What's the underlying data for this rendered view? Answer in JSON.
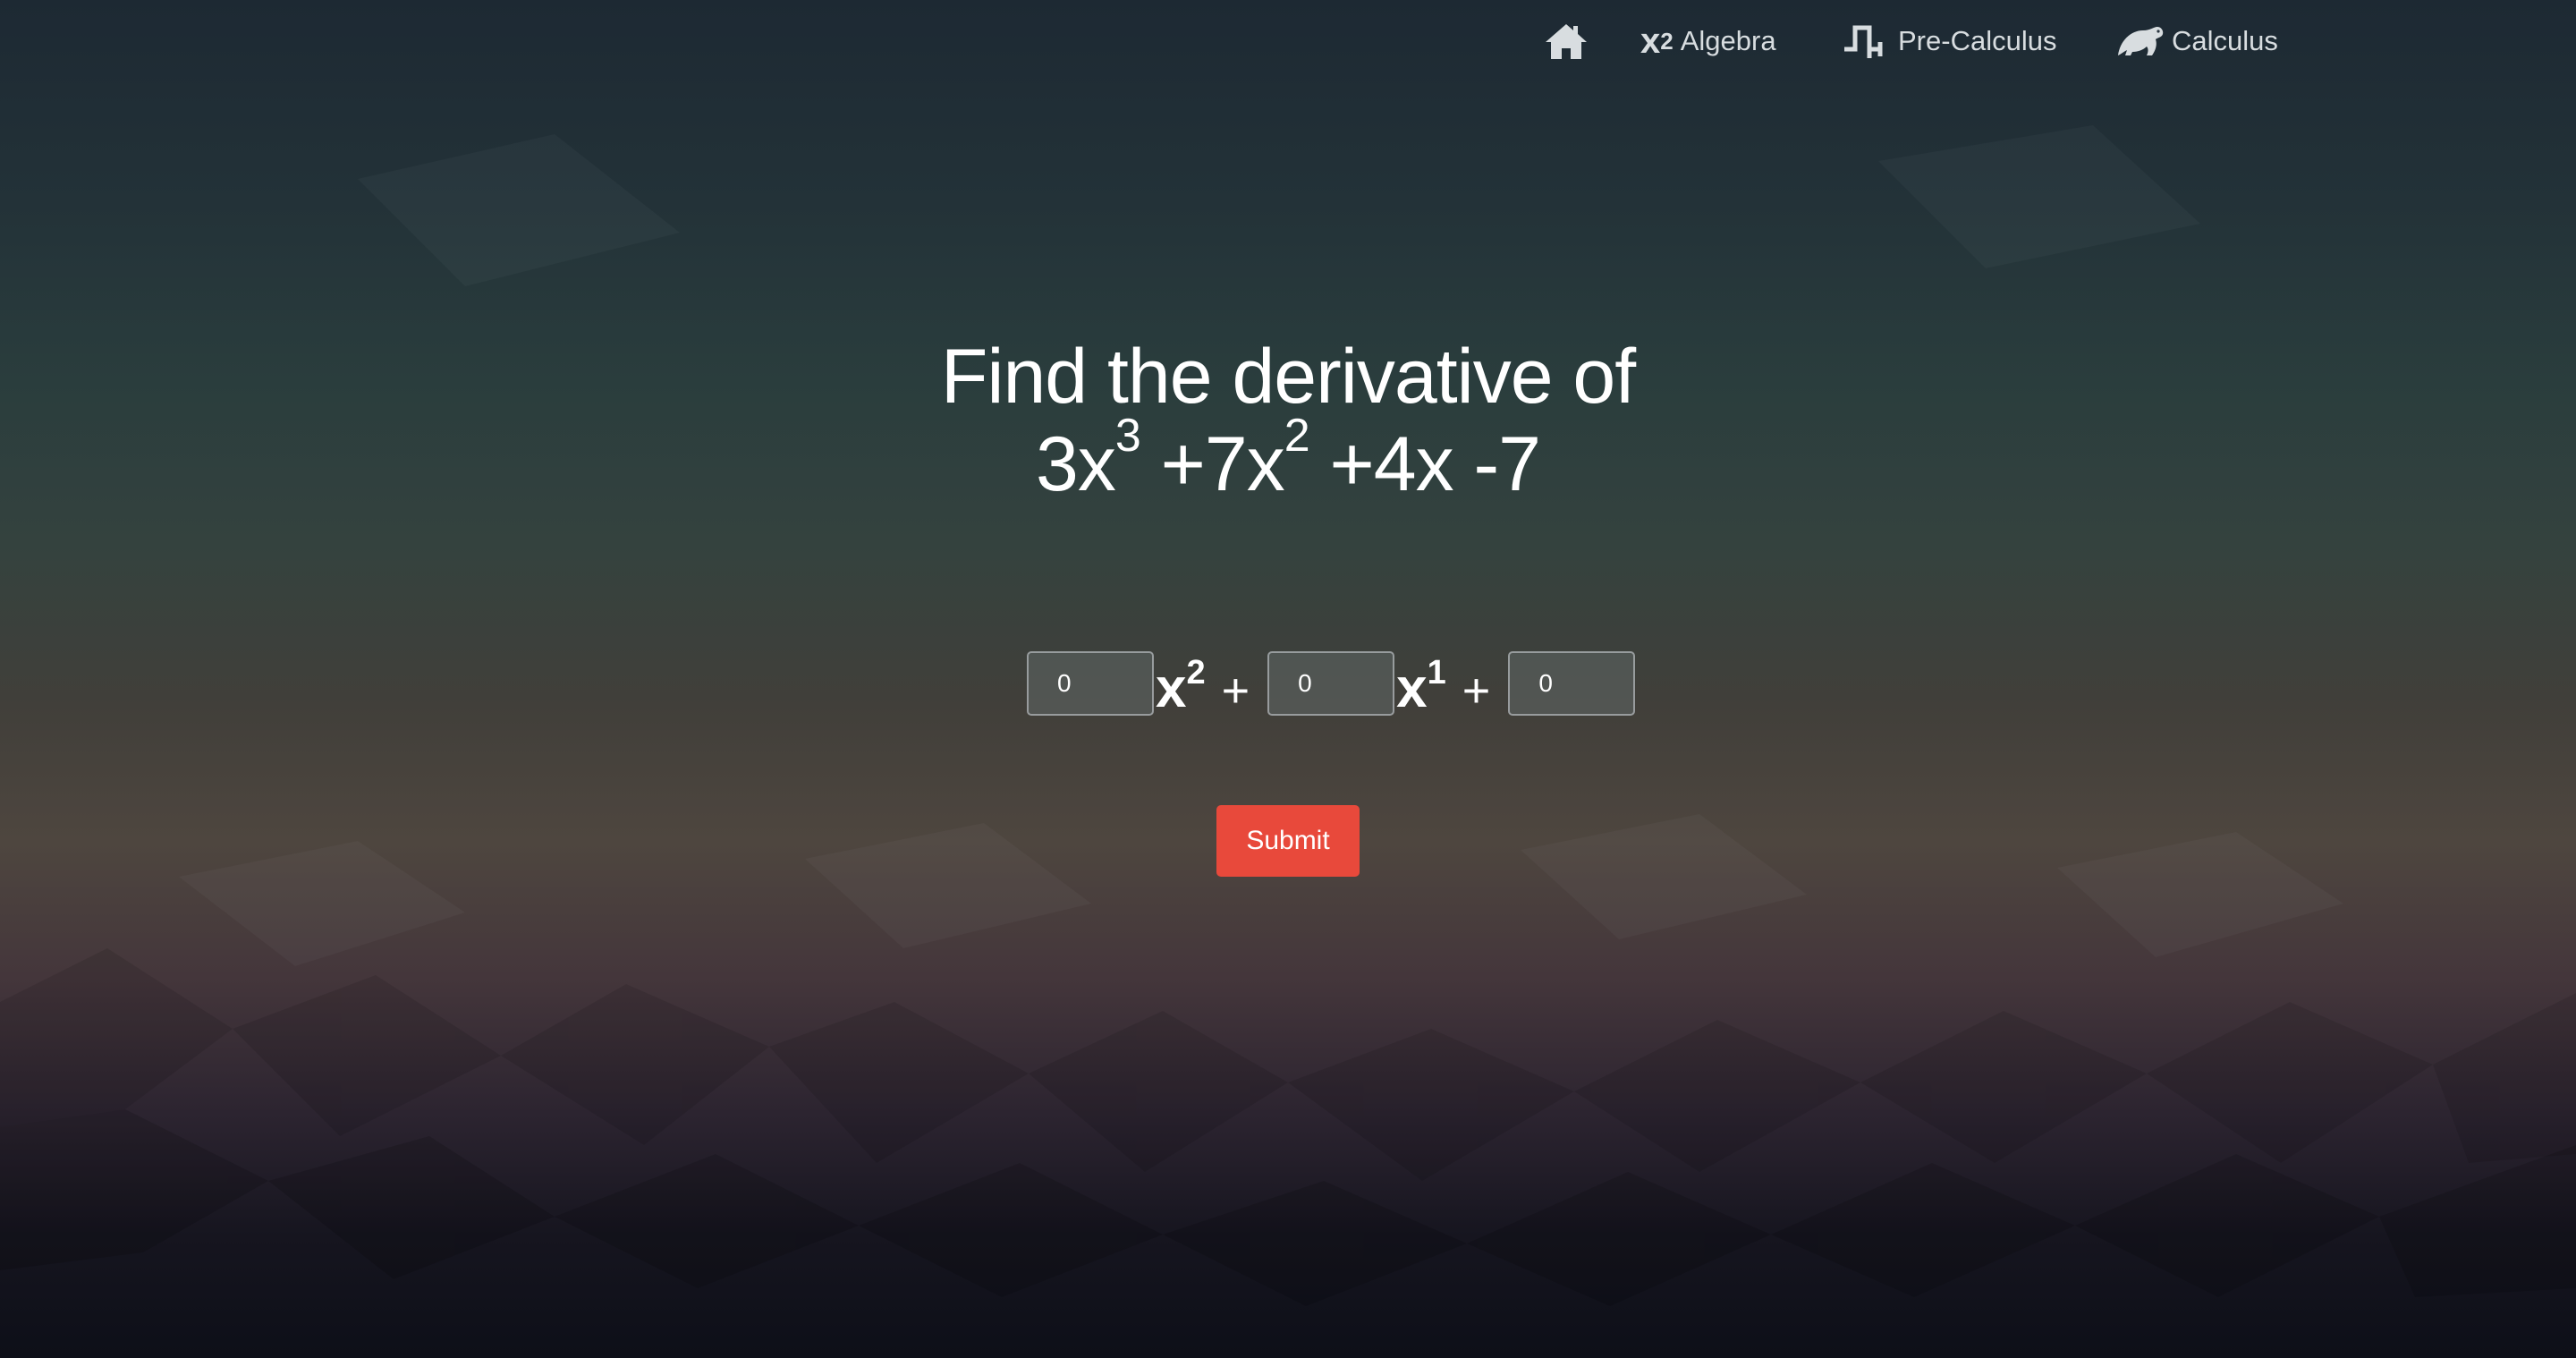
{
  "nav": {
    "home_icon": "home-icon",
    "items": [
      {
        "icon": "x-squared-icon",
        "icon_text_base": "x",
        "icon_text_sup": "2",
        "label": "Algebra"
      },
      {
        "icon": "step-function-icon",
        "label": "Pre-Calculus"
      },
      {
        "icon": "dinosaur-icon",
        "label": "Calculus"
      }
    ]
  },
  "question": {
    "prompt": "Find the derivative of",
    "terms": [
      {
        "coef": "3x",
        "exp": "3"
      },
      {
        "coef": " +7x",
        "exp": "2"
      },
      {
        "tail": " +4x -7"
      }
    ]
  },
  "answer": {
    "inputs": [
      "0",
      "0",
      "0"
    ],
    "terms": [
      {
        "base": "x",
        "exp": "2"
      },
      {
        "base": "x",
        "exp": "1"
      }
    ],
    "plus": "+"
  },
  "submit_label": "Submit",
  "colors": {
    "accent": "#e8493b",
    "nav_text": "#d8dde0"
  }
}
